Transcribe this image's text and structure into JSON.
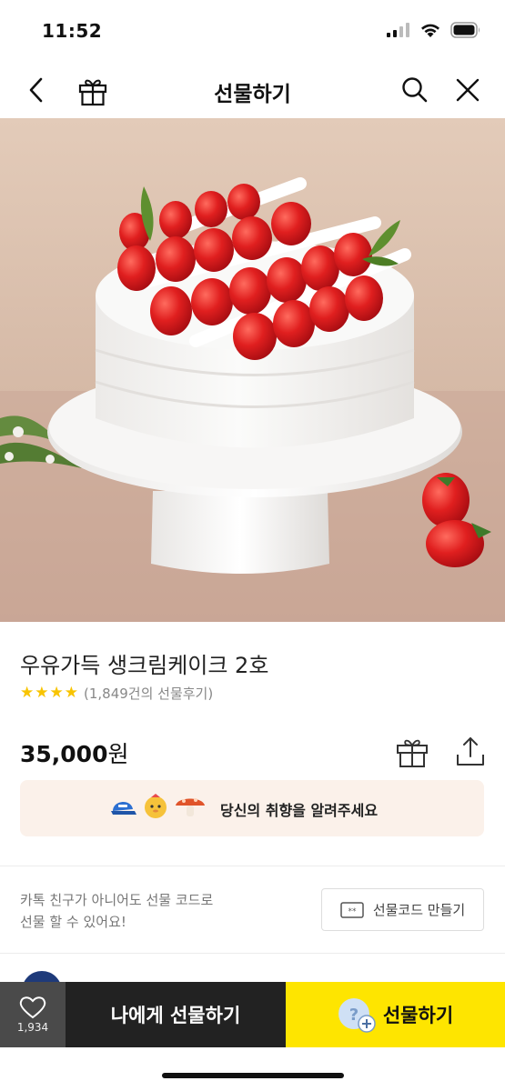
{
  "status_bar": {
    "time": "11:52",
    "icons": [
      "signal-icon",
      "wifi-icon",
      "battery-icon"
    ]
  },
  "nav": {
    "title": "선물하기",
    "icons": [
      "back-icon",
      "gift-icon",
      "search-icon",
      "close-icon"
    ]
  },
  "product": {
    "image": "strawberry-cream-cake-photo",
    "name": "우유가득 생크림케이크 2호",
    "rating_stars": 4,
    "review_count": "(1,849건의 선물후기)",
    "price": "35,000",
    "price_unit": "원"
  },
  "taste_banner": {
    "text": "당신의 취향을 알려주세요",
    "icons": [
      "cap-icon",
      "character-icon",
      "mushroom-icon"
    ]
  },
  "gift_code": {
    "description_line1": "카톡 친구가 아니어도 선물 코드로",
    "description_line2": "선물 할 수 있어요!",
    "button_label": "선물코드 만들기"
  },
  "bottom_bar": {
    "like_count": "1,934",
    "self_gift_label": "나에게 선물하기",
    "gift_label": "선물하기"
  },
  "colors": {
    "accent_yellow": "#fee500",
    "dark_button": "#222222",
    "star": "#f8c400",
    "banner_bg": "#fbf1ea"
  }
}
